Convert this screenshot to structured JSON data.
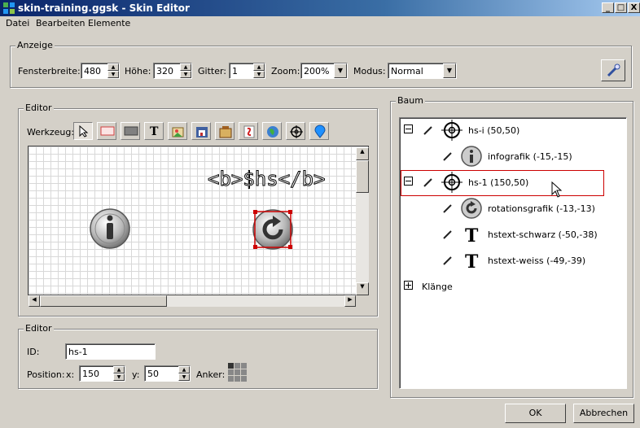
{
  "window": {
    "title": "skin-training.ggsk - Skin Editor",
    "minimize": "_",
    "maximize": "□",
    "close": "X"
  },
  "menu": [
    "Datei",
    "Bearbeiten",
    "Elemente"
  ],
  "anzeige": {
    "legend": "Anzeige",
    "fensterbreite_label": "Fensterbreite:",
    "fensterbreite_value": "480",
    "hoehe_label": "Höhe:",
    "hoehe_value": "320",
    "gitter_label": "Gitter:",
    "gitter_value": "1",
    "zoom_label": "Zoom:",
    "zoom_value": "200%",
    "modus_label": "Modus:",
    "modus_value": "Normal"
  },
  "editor": {
    "legend": "Editor",
    "werkzeug_label": "Werkzeug:",
    "tools": [
      "select-tool",
      "rectangle-outline-tool",
      "rectangle-fill-tool",
      "text-tool",
      "image-tool",
      "button-tool",
      "container-tool",
      "flash-tool",
      "globe-tool",
      "hotspot-tool",
      "pin-tool"
    ],
    "canvas_text": "<b>$hs</b>"
  },
  "props": {
    "legend": "Editor",
    "id_label": "ID:",
    "id_value": "hs-1",
    "position_label": "Position:",
    "x_label": "x:",
    "x_value": "150",
    "y_label": "y:",
    "y_value": "50",
    "anker_label": "Anker:"
  },
  "baum": {
    "legend": "Baum",
    "nodes": [
      {
        "label": "hs-i (50,50)",
        "icon": "crosshair-icon"
      },
      {
        "label": "infografik (-15,-15)",
        "icon": "info-icon"
      },
      {
        "label": "hs-1 (150,50)",
        "icon": "crosshair-icon",
        "selected": true
      },
      {
        "label": "rotationsgrafik (-13,-13)",
        "icon": "rotate-icon"
      },
      {
        "label": "hstext-schwarz (-50,-38)",
        "icon": "text-icon"
      },
      {
        "label": "hstext-weiss (-49,-39)",
        "icon": "text-icon"
      },
      {
        "label": "Klänge",
        "icon": "expander-plus-icon"
      }
    ]
  },
  "buttons": {
    "ok": "OK",
    "cancel": "Abbrechen"
  },
  "colors": {
    "titlebar": "#0a246a",
    "selection": "#cc0000",
    "face": "#d4d0c8"
  }
}
